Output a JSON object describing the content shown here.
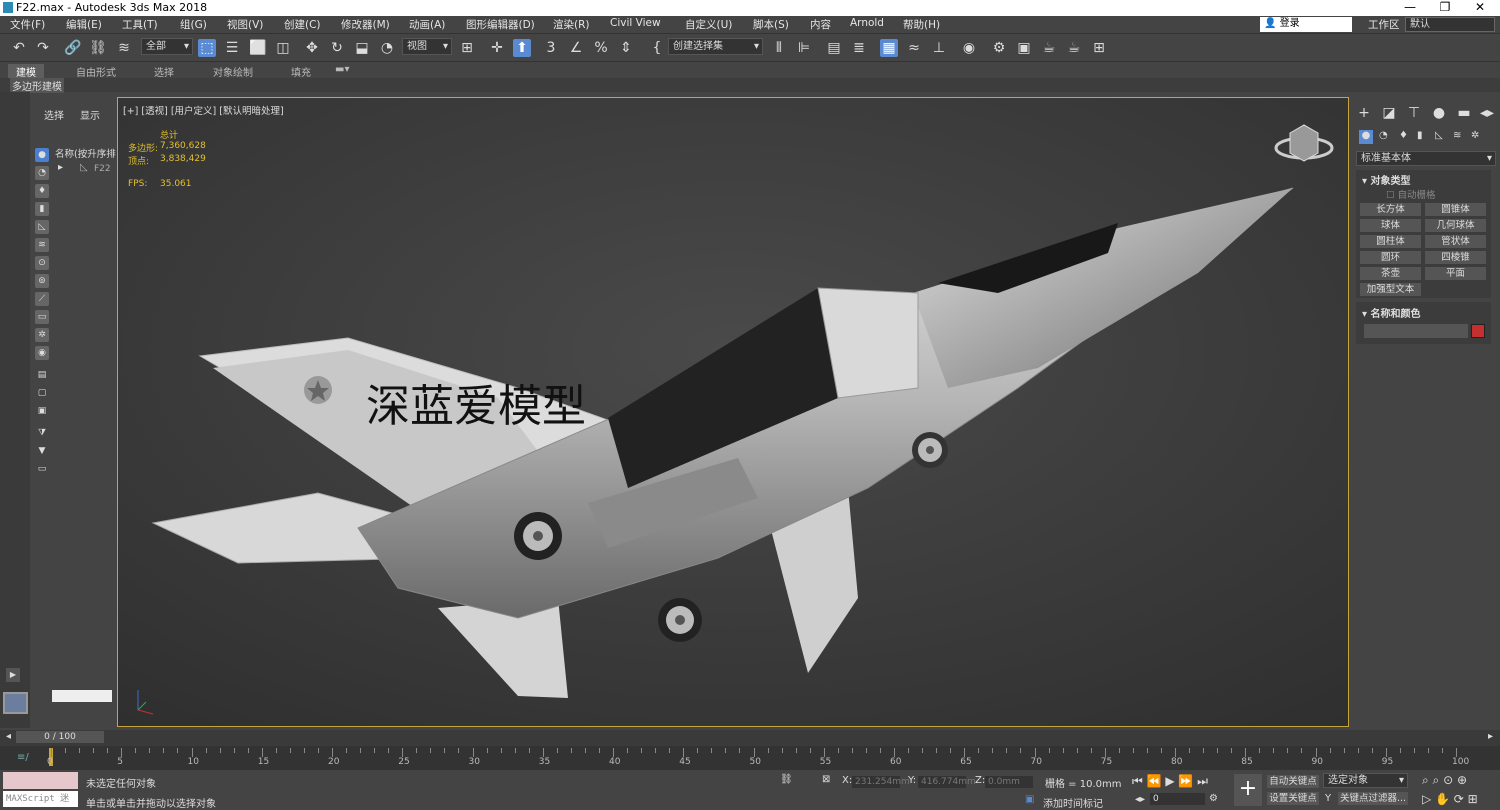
{
  "window": {
    "title": "F22.max - Autodesk 3ds Max 2018",
    "controls": [
      "—",
      "❐",
      "✕"
    ]
  },
  "menu": [
    "文件(F)",
    "编辑(E)",
    "工具(T)",
    "组(G)",
    "视图(V)",
    "创建(C)",
    "修改器(M)",
    "动画(A)",
    "图形编辑器(D)",
    "渲染(R)",
    "Civil View",
    "自定义(U)",
    "脚本(S)",
    "内容",
    "Arnold",
    "帮助(H)"
  ],
  "account": {
    "login": "登录",
    "workspace_label": "工作区",
    "workspace_value": "默认"
  },
  "toolbar": {
    "filter": "全部",
    "ref_coord": "视图",
    "selection_set": "创建选择集"
  },
  "ribbon": {
    "tabs": [
      "建模",
      "自由形式",
      "选择",
      "对象绘制",
      "填充"
    ],
    "sub": "多边形建模"
  },
  "scene": {
    "tab_select": "选择",
    "tab_display": "显示",
    "header": "名称(按升序排",
    "item": "F22"
  },
  "viewport": {
    "label": "[+] [透视] [用户定义] [默认明暗处理]",
    "stats_total": "总计",
    "polys_label": "多边形:",
    "polys": "7,360,628",
    "verts_label": "顶点:",
    "verts": "3,838,429",
    "fps_label": "FPS:",
    "fps": "35.061",
    "watermark": "深蓝爱模型"
  },
  "command_panel": {
    "category": "标准基本体",
    "section_object_type": "对象类型",
    "autogrid": "自动栅格",
    "buttons": [
      "长方体",
      "圆锥体",
      "球体",
      "几何球体",
      "圆柱体",
      "管状体",
      "圆环",
      "四棱锥",
      "茶壶",
      "平面",
      "加强型文本"
    ],
    "section_name_color": "名称和颜色",
    "color": "#c43030"
  },
  "timeline": {
    "frame": "0 / 100",
    "ticks": [
      "0",
      "5",
      "10",
      "15",
      "20",
      "25",
      "30",
      "35",
      "40",
      "45",
      "50",
      "55",
      "60",
      "65",
      "70",
      "75",
      "80",
      "85",
      "90",
      "95",
      "100"
    ]
  },
  "status": {
    "script": "MAXScript 迷",
    "line1": "未选定任何对象",
    "line2": "单击或单击并拖动以选择对象",
    "x": "231.254mm",
    "y": "416.774mm",
    "z": "0.0mm",
    "grid": "栅格 = 10.0mm",
    "add_time_tag": "添加时间标记",
    "auto_key": "自动关键点",
    "set_key": "设置关键点",
    "selected": "选定对象",
    "key_filters": "关键点过滤器...",
    "frame_value": "0"
  }
}
